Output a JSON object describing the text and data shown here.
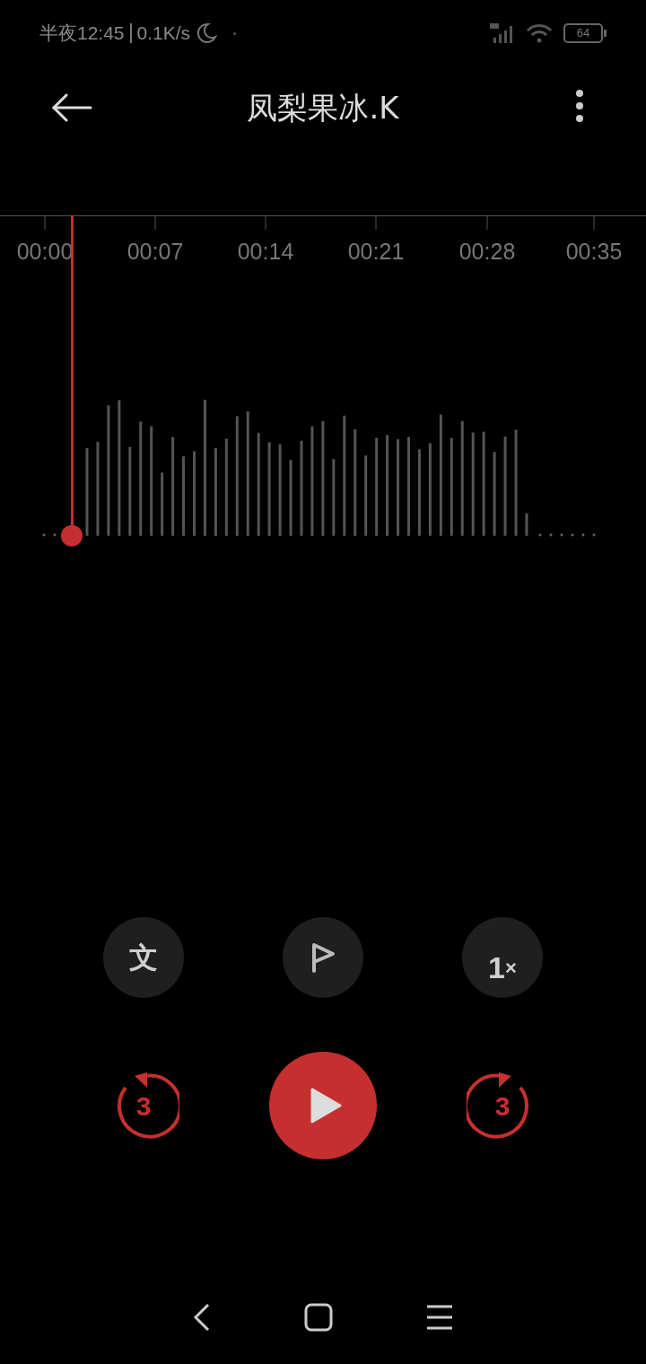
{
  "status_bar": {
    "time": "半夜12:45",
    "speed": "0.1K/s",
    "battery": "64"
  },
  "title": "凤梨果冰.K",
  "timeline": {
    "labels": [
      "00:00",
      "00:07",
      "00:14",
      "00:21",
      "00:28",
      "00:35"
    ]
  },
  "tools": [
    {
      "kind": "text",
      "label": "文"
    },
    {
      "kind": "flag"
    },
    {
      "kind": "speed",
      "value": "1",
      "unit": "×"
    }
  ],
  "playback": {
    "rewind": "3",
    "forward": "3",
    "playing": false
  }
}
